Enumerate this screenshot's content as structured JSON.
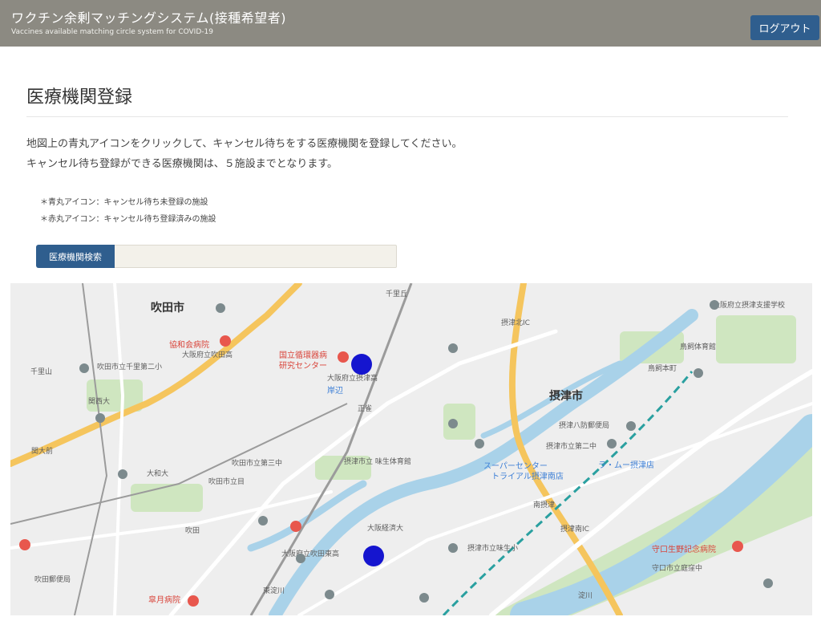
{
  "header": {
    "title": "ワクチン余剰マッチングシステム(接種希望者)",
    "subtitle": "Vaccines available matching circle system for COVID-19",
    "logout_label": "ログアウト"
  },
  "page": {
    "title": "医療機関登録",
    "description_line1": "地図上の青丸アイコンをクリックして、キャンセル待ちをする医療機関を登録してください。",
    "description_line2": "キャンセル待ち登録ができる医療機関は、５施設までとなります。",
    "legend_blue": "＊青丸アイコン：キャンセル待ち未登録の施設",
    "legend_red": "＊赤丸アイコン：キャンセル待ち登録済みの施設"
  },
  "search": {
    "button_label": "医療機関検索",
    "value": "",
    "placeholder": ""
  },
  "map": {
    "labels": {
      "suita": "吹田市",
      "settsu": "摂津市",
      "kyowakai": "協和会病院",
      "ncvc_line1": "国立循環器病",
      "ncvc_line2": "研究センター",
      "kishibe": "岸辺",
      "shoujaku": "正雀",
      "senriyama": "千里山",
      "kandai": "関大前",
      "kansaidai": "関西大",
      "supercenter_line1": "スーパーセンター",
      "supercenter_line2": "トライアル摂津南店",
      "lamu": "ラ・ムー摂津店",
      "moriguchi": "守口生野記念病院",
      "satsuki": "皐月病院",
      "osaka_keizai": "大阪経済大",
      "minami_settsu": "南摂津",
      "suita_station": "吹田",
      "settsu_hs": "大阪府立摂津高",
      "kamo_hs": "大阪府立吹田高",
      "yakushiji": "吹田市立千里第二小",
      "settsu_gym": "摂津市立 味生体育館",
      "torikai": "鳥飼本町",
      "aji_sho": "摂津市立味生小",
      "settsu_tsu": "摂津市立第二中",
      "settsu_8": "摂津八防郵便局",
      "suita_3": "吹田市立第三中",
      "suita_gym": "吹田市立目",
      "osaka_kyoiku": "大阪府立吹田東高",
      "yodogawa": "淀川",
      "suita_post": "吹田郵便局",
      "wadai": "大和大",
      "torikai_hs": "大阪府立摂津支援学校",
      "kirin": "鳥飼体育館",
      "hosenji": "千里丘",
      "moriguchi_city": "守口市立庭窪中",
      "higashi_yodo": "東淀川",
      "shinyodo": "摂津南IC",
      "settsu_ic": "摂津北IC"
    },
    "markers": [
      {
        "name": "medical-facility-marker-1",
        "status": "unregistered",
        "color": "#1515cf"
      },
      {
        "name": "medical-facility-marker-2",
        "status": "unregistered",
        "color": "#1515cf"
      }
    ]
  },
  "colors": {
    "header_bg": "#8c8a82",
    "button_bg": "#2f5e8e",
    "marker_blue": "#1515cf",
    "river": "#a9d2e9",
    "park": "#c9e4b9"
  }
}
